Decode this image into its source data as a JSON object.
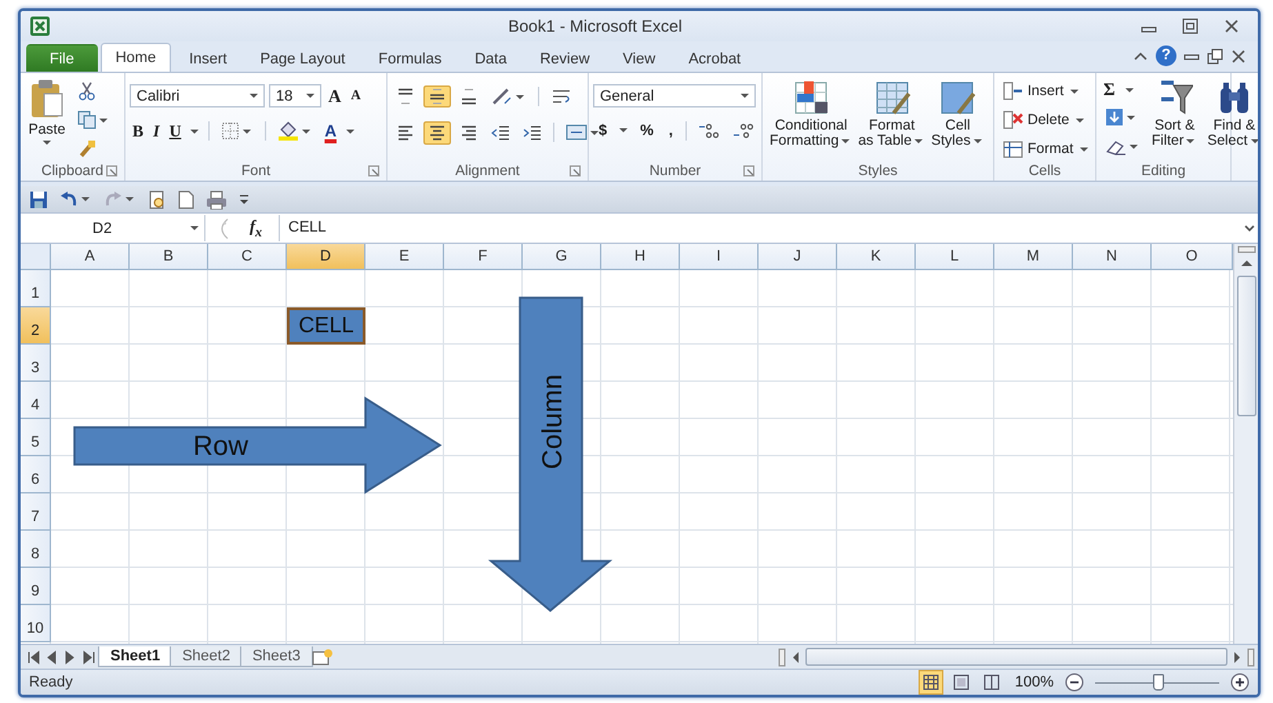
{
  "window": {
    "title": "Book1 - Microsoft Excel"
  },
  "tabs": [
    {
      "label": "File",
      "kind": "file",
      "selected": false
    },
    {
      "label": "Home",
      "kind": "tab",
      "selected": true
    },
    {
      "label": "Insert",
      "kind": "tab",
      "selected": false
    },
    {
      "label": "Page Layout",
      "kind": "tab",
      "selected": false
    },
    {
      "label": "Formulas",
      "kind": "tab",
      "selected": false
    },
    {
      "label": "Data",
      "kind": "tab",
      "selected": false
    },
    {
      "label": "Review",
      "kind": "tab",
      "selected": false
    },
    {
      "label": "View",
      "kind": "tab",
      "selected": false
    },
    {
      "label": "Acrobat",
      "kind": "tab",
      "selected": false
    }
  ],
  "help": "?",
  "ribbon": {
    "clipboard": {
      "label": "Clipboard",
      "paste": "Paste"
    },
    "font": {
      "label": "Font",
      "font_name": "Calibri",
      "font_size": "18",
      "grow": "A",
      "shrink": "A",
      "styles": [
        "B",
        "I",
        "U"
      ],
      "font_color": "A"
    },
    "alignment": {
      "label": "Alignment",
      "vertical": [
        {
          "selected": false
        },
        {
          "selected": true
        },
        {
          "selected": false
        }
      ],
      "horizontal": [
        {
          "selected": false
        },
        {
          "selected": true
        },
        {
          "selected": false
        }
      ]
    },
    "number": {
      "label": "Number",
      "format": "General",
      "symbols": [
        "$",
        "%",
        ","
      ]
    },
    "styles": {
      "label": "Styles",
      "buttons": [
        {
          "lines": [
            "Conditional",
            "Formatting"
          ],
          "kind": "conditional"
        },
        {
          "lines": [
            "Format",
            "as Table"
          ],
          "kind": "table"
        },
        {
          "lines": [
            "Cell",
            "Styles"
          ],
          "kind": "cell"
        }
      ]
    },
    "cells": {
      "label": "Cells",
      "buttons": [
        {
          "label": "Insert",
          "kind": "insert"
        },
        {
          "label": "Delete",
          "kind": "delete"
        },
        {
          "label": "Format",
          "kind": "format"
        }
      ]
    },
    "editing": {
      "label": "Editing",
      "sum": "Σ",
      "buttons": [
        {
          "lines": [
            "Sort &",
            "Filter"
          ],
          "kind": "sort"
        },
        {
          "lines": [
            "Find &",
            "Select"
          ],
          "kind": "find"
        }
      ]
    }
  },
  "formula_bar": {
    "name_box": "D2",
    "function_label": "f$_{x}$",
    "value": "CELL"
  },
  "columns": [
    {
      "label": "A",
      "selected": false
    },
    {
      "label": "B",
      "selected": false
    },
    {
      "label": "C",
      "selected": false
    },
    {
      "label": "D",
      "selected": true
    },
    {
      "label": "E",
      "selected": false
    },
    {
      "label": "F",
      "selected": false
    },
    {
      "label": "G",
      "selected": false
    },
    {
      "label": "H",
      "selected": false
    },
    {
      "label": "I",
      "selected": false
    },
    {
      "label": "J",
      "selected": false
    },
    {
      "label": "K",
      "selected": false
    },
    {
      "label": "L",
      "selected": false
    },
    {
      "label": "M",
      "selected": false
    },
    {
      "label": "N",
      "selected": false
    },
    {
      "label": "O",
      "selected": false
    }
  ],
  "rows": [
    {
      "label": "1",
      "selected": false
    },
    {
      "label": "2",
      "selected": true
    },
    {
      "label": "3",
      "selected": false
    },
    {
      "label": "4",
      "selected": false
    },
    {
      "label": "5",
      "selected": false
    },
    {
      "label": "6",
      "selected": false
    },
    {
      "label": "7",
      "selected": false
    },
    {
      "label": "8",
      "selected": false
    },
    {
      "label": "9",
      "selected": false
    },
    {
      "label": "10",
      "selected": false
    }
  ],
  "active_cell": {
    "value": "CELL"
  },
  "shapes": [
    {
      "kind": "right_arrow",
      "label": "Row"
    },
    {
      "kind": "down_arrow",
      "label": "Column"
    }
  ],
  "sheet_tabs": [
    {
      "label": "Sheet1",
      "selected": true
    },
    {
      "label": "Sheet2",
      "selected": false
    },
    {
      "label": "Sheet3",
      "selected": false
    }
  ],
  "status_bar": {
    "status": "Ready",
    "views": [
      {
        "selected": true
      },
      {
        "selected": false
      },
      {
        "selected": false
      }
    ],
    "zoom": "100%",
    "zoom_slider": {
      "level": 0.5
    }
  }
}
